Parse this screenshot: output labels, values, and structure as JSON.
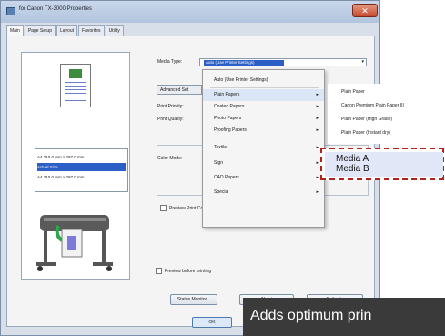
{
  "window": {
    "title": "for Canon TX-3000 Properties",
    "close_glyph": "✕",
    "tabs": [
      "Main",
      "Page Setup",
      "Layout",
      "Favorites",
      "Utility"
    ]
  },
  "preview": {
    "sizes": [
      "A4 210.0 mm x 297.0 mm",
      "Actual Size",
      "A4 210.0 mm x 297.0 mm"
    ],
    "selected_index": 1
  },
  "settings": {
    "media_type_label": "Media Type:",
    "media_type_value": "Auto (Use Printer Settings)",
    "advanced_label": "Advanced Set",
    "print_priority_label": "Print Priority:",
    "print_quality_label": "Print Quality:",
    "color_mode_label": "Color Mode:",
    "preview_label": "Preview Print Color",
    "preview_before_label": "Preview before printing",
    "status_monitor_label": "Status Monitor...",
    "about_label": "About",
    "defaults_label": "Defaults",
    "ok_label": "OK"
  },
  "menu": {
    "items": [
      {
        "label": "Auto (Use Printer Settings)",
        "submenu": false
      },
      {
        "label": "Plain Papers",
        "submenu": true
      },
      {
        "label": "Coated Papers",
        "submenu": true
      },
      {
        "label": "Photo Papers",
        "submenu": true
      },
      {
        "label": "Proofing Papers",
        "submenu": true
      },
      {
        "label": "Textile",
        "submenu": true
      },
      {
        "label": "Sign",
        "submenu": true
      },
      {
        "label": "CAD Papers",
        "submenu": true
      },
      {
        "label": "Special",
        "submenu": true
      }
    ],
    "submenu_glyph": "▸"
  },
  "submenu": {
    "items": [
      "Plain Paper",
      "Canon Premium Plain Paper III",
      "Plain Paper (High Grade)",
      "Plain Paper (Instant dry)"
    ]
  },
  "highlight": {
    "items": [
      "Media A",
      "Media B"
    ],
    "border_color": "#b0221a"
  },
  "tooltip": {
    "text": "Adds optimum prin"
  },
  "colors": {
    "selection": "#2b5fc6",
    "menu_highlight": "#dbe7f7"
  }
}
